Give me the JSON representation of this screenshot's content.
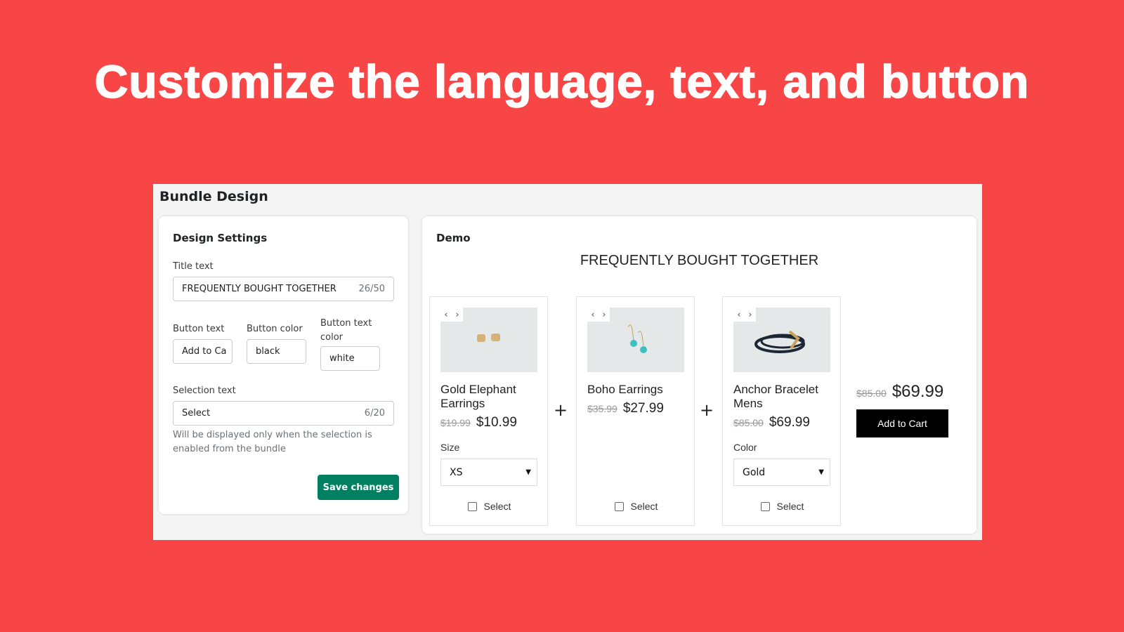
{
  "headline": "Customize the language, text, and button",
  "page_title": "Bundle Design",
  "settings": {
    "heading": "Design Settings",
    "title_label": "Title text",
    "title_value": "FREQUENTLY BOUGHT TOGETHER",
    "title_count": "26/50",
    "button_text_label": "Button text",
    "button_text_value": "Add to Ca",
    "button_color_label": "Button color",
    "button_color_value": "black",
    "button_text_color_label": "Button text color",
    "button_text_color_value": "white",
    "selection_label": "Selection text",
    "selection_value": "Select",
    "selection_count": "6/20",
    "selection_help": "Will be displayed only when the selection is enabled from the bundle",
    "save_label": "Save changes",
    "accent": "#008060"
  },
  "demo": {
    "heading": "Demo",
    "bundle_title": "FREQUENTLY BOUGHT TOGETHER",
    "products": [
      {
        "name": "Gold Elephant Earrings",
        "old_price": "$19.99",
        "price": "$10.99",
        "option_label": "Size",
        "option_value": "XS",
        "select_label": "Select"
      },
      {
        "name": "Boho Earrings",
        "old_price": "$35.99",
        "price": "$27.99",
        "select_label": "Select"
      },
      {
        "name": "Anchor Bracelet Mens",
        "old_price": "$85.00",
        "price": "$69.99",
        "option_label": "Color",
        "option_value": "Gold",
        "select_label": "Select"
      }
    ],
    "plus": "+",
    "total_old": "$85.00",
    "total": "$69.99",
    "cart_button": "Add to Cart",
    "cart_button_color": "#000000",
    "cart_button_text_color": "#ffffff"
  },
  "background": "#f84646"
}
